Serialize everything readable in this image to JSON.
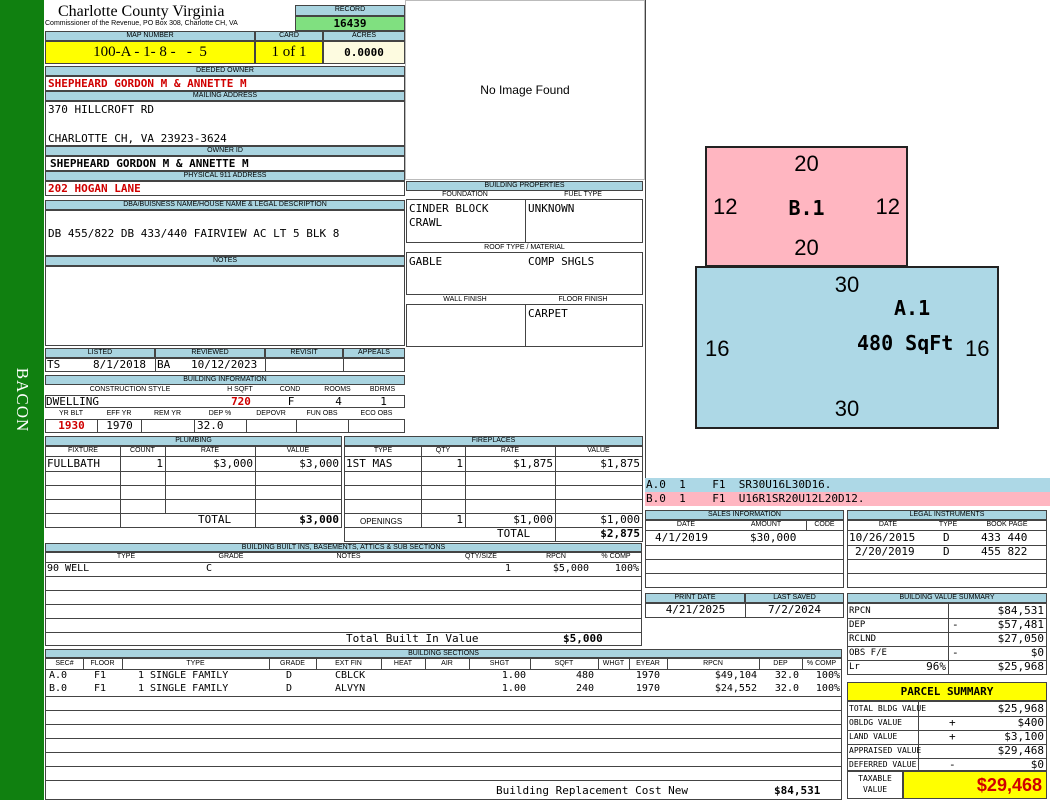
{
  "sidebar": {
    "text": "BACON"
  },
  "header": {
    "county": "Charlotte County Virginia",
    "commissioner": "Commissioner of the Revenue, PO Box 308, Charlotte CH, VA",
    "record_label": "RECORD",
    "record": "16439",
    "map_number_label": "MAP NUMBER",
    "map_number": "100-A - 1- 8 -   -  5",
    "card_label": "CARD",
    "card": "1 of 1",
    "acres_label": "ACRES",
    "acres": "0.0000"
  },
  "owner": {
    "deeded_owner_label": "DEEDED OWNER",
    "deeded_owner": "SHEPHEARD GORDON M & ANNETTE M",
    "mailing_label": "MAILING ADDRESS",
    "mailing_line1": "370 HILLCROFT RD",
    "mailing_line2": "CHARLOTTE CH, VA 23923-3624",
    "owner_id_label": "OWNER ID",
    "owner_id": "SHEPHEARD GORDON M & ANNETTE M",
    "physical_label": "PHYSICAL 911 ADDRESS",
    "physical": "202 HOGAN LANE",
    "legal_label": "DBA/BUISNESS NAME/HOUSE NAME & LEGAL DESCRIPTION",
    "legal": "DB 455/822 DB 433/440 FAIRVIEW AC LT 5 BLK 8",
    "notes_label": "NOTES"
  },
  "image": {
    "no_image": "No Image Found"
  },
  "building_properties": {
    "title": "BUILDING PROPERTIES",
    "foundation_label": "FOUNDATION",
    "foundation": [
      "CINDER BLOCK",
      "CRAWL"
    ],
    "fuel_label": "FUEL TYPE",
    "fuel": "UNKNOWN",
    "roof_label": "ROOF TYPE / MATERIAL",
    "roof_type": "GABLE",
    "roof_material": "COMP SHGLS",
    "wall_label": "WALL FINISH",
    "floor_label": "FLOOR FINISH",
    "floor": "CARPET"
  },
  "sketch": {
    "b1": {
      "label": "B.1",
      "top": "20",
      "bottom": "20",
      "left": "12",
      "right": "12"
    },
    "a1": {
      "label": "A.1",
      "area": "480 SqFt",
      "top": "30",
      "bottom": "30",
      "left": "16",
      "right": "16"
    },
    "lines": [
      "A.0  1    F1  SR30U16L30D16.",
      "B.0  1    F1  U16R1SR20U12L20D12."
    ]
  },
  "listing": {
    "listed_label": "LISTED",
    "listed_by": "TS",
    "listed_date": "8/1/2018",
    "reviewed_label": "REVIEWED",
    "reviewed_by": "BA",
    "reviewed_date": "10/12/2023",
    "revisit_label": "REVISIT",
    "appeals_label": "APPEALS"
  },
  "building_info": {
    "title": "BUILDING INFORMATION",
    "h_style": "CONSTRUCTION STYLE",
    "h_hsqft": "H SQFT",
    "h_cond": "COND",
    "h_rooms": "ROOMS",
    "h_bdrms": "BDRMS",
    "style": "DWELLING",
    "hsqft": "720",
    "cond": "F",
    "rooms": "4",
    "bdrms": "1",
    "h_yrblt": "YR BLT",
    "h_effyr": "EFF YR",
    "h_remyr": "REM YR",
    "h_dep": "DEP %",
    "h_depovr": "DEPOVR",
    "h_funobs": "FUN OBS",
    "h_ecoobs": "ECO OBS",
    "yrblt": "1930",
    "effyr": "1970",
    "dep": "32.0"
  },
  "plumbing": {
    "title": "PLUMBING",
    "h_fixture": "FIXTURE",
    "h_count": "COUNT",
    "h_rate": "RATE",
    "h_value": "VALUE",
    "rows": [
      {
        "fixture": "FULLBATH",
        "count": "1",
        "rate": "$3,000",
        "value": "$3,000"
      }
    ],
    "total_label": "TOTAL",
    "total": "$3,000"
  },
  "fireplaces": {
    "title": "FIREPLACES",
    "h_type": "TYPE",
    "h_qty": "QTY",
    "h_rate": "RATE",
    "h_value": "VALUE",
    "rows": [
      {
        "type": "1ST MAS",
        "qty": "1",
        "rate": "$1,875",
        "value": "$1,875"
      }
    ],
    "openings_label": "OPENINGS",
    "openings_qty": "1",
    "openings_rate": "$1,000",
    "openings_value": "$1,000",
    "total_label": "TOTAL",
    "total": "$2,875"
  },
  "sales": {
    "title": "SALES INFORMATION",
    "h_date": "DATE",
    "h_amount": "AMOUNT",
    "h_code": "CODE",
    "rows": [
      {
        "date": "4/1/2019",
        "amount": "$30,000",
        "code": ""
      }
    ]
  },
  "legal_instruments": {
    "title": "LEGAL INSTRUMENTS",
    "h_date": "DATE",
    "h_type": "TYPE",
    "h_bookpage": "BOOK PAGE",
    "rows": [
      {
        "date": "10/26/2015",
        "type": "D",
        "bookpage": "433 440"
      },
      {
        "date": "2/20/2019",
        "type": "D",
        "bookpage": "455 822"
      }
    ]
  },
  "built_ins": {
    "title": "BUILDING BUILT INS, BASEMENTS, ATTICS & SUB SECTIONS",
    "h_type": "TYPE",
    "h_grade": "GRADE",
    "h_notes": "NOTES",
    "h_qty": "QTY/SIZE",
    "h_rpcn": "RPCN",
    "h_comp": "% COMP",
    "rows": [
      {
        "type": "90 WELL",
        "grade": "C",
        "notes": "",
        "qty": "1",
        "rpcn": "$5,000",
        "comp": "100%"
      }
    ],
    "total_label": "Total Built In Value",
    "total": "$5,000"
  },
  "print_info": {
    "print_label": "PRINT DATE",
    "print_date": "4/21/2025",
    "saved_label": "LAST SAVED",
    "saved_date": "7/2/2024"
  },
  "value_summary": {
    "title": "BUILDING VALUE SUMMARY",
    "rows": [
      {
        "label": "RPCN",
        "sign": "",
        "pct": "",
        "value": "$84,531"
      },
      {
        "label": "DEP",
        "sign": "-",
        "pct": "",
        "value": "$57,481"
      },
      {
        "label": "RCLND",
        "sign": "",
        "pct": "",
        "value": "$27,050"
      },
      {
        "label": "OBS F/E",
        "sign": "-",
        "pct": "",
        "value": "$0"
      },
      {
        "label": "Lr",
        "sign": "",
        "pct": "96%",
        "value": "$25,968"
      }
    ]
  },
  "parcel_summary": {
    "title": "PARCEL SUMMARY",
    "rows": [
      {
        "label": "TOTAL BLDG VALUE",
        "sign": "",
        "value": "$25,968"
      },
      {
        "label": "OBLDG VALUE",
        "sign": "+",
        "value": "$400"
      },
      {
        "label": "LAND VALUE",
        "sign": "+",
        "value": "$3,100"
      },
      {
        "label": "APPRAISED VALUE",
        "sign": "",
        "value": "$29,468"
      },
      {
        "label": "DEFERRED VALUE",
        "sign": "-",
        "value": "$0"
      }
    ],
    "taxable_label_1": "TAXABLE",
    "taxable_label_2": "VALUE",
    "taxable": "$29,468"
  },
  "sections": {
    "title": "BUILDING SECTIONS",
    "headers": [
      "SEC#",
      "FLOOR",
      "TYPE",
      "GRADE",
      "EXT FIN",
      "HEAT",
      "AIR",
      "SHGT",
      "SQFT",
      "WHGT",
      "EYEAR",
      "RPCN",
      "DEP",
      "% COMP"
    ],
    "rows": [
      {
        "sec": "A.0",
        "floor": "F1",
        "type": "1 SINGLE FAMILY",
        "grade": "D",
        "extfin": "CBLCK",
        "heat": "",
        "air": "",
        "shgt": "1.00",
        "sqft": "480",
        "whgt": "",
        "eyear": "1970",
        "rpcn": "$49,104",
        "dep": "32.0",
        "comp": "100%"
      },
      {
        "sec": "B.0",
        "floor": "F1",
        "type": "1 SINGLE FAMILY",
        "grade": "D",
        "extfin": "ALVYN",
        "heat": "",
        "air": "",
        "shgt": "1.00",
        "sqft": "240",
        "whgt": "",
        "eyear": "1970",
        "rpcn": "$24,552",
        "dep": "32.0",
        "comp": "100%"
      }
    ],
    "replacement_label": "Building Replacement Cost New",
    "replacement": "$84,531"
  }
}
